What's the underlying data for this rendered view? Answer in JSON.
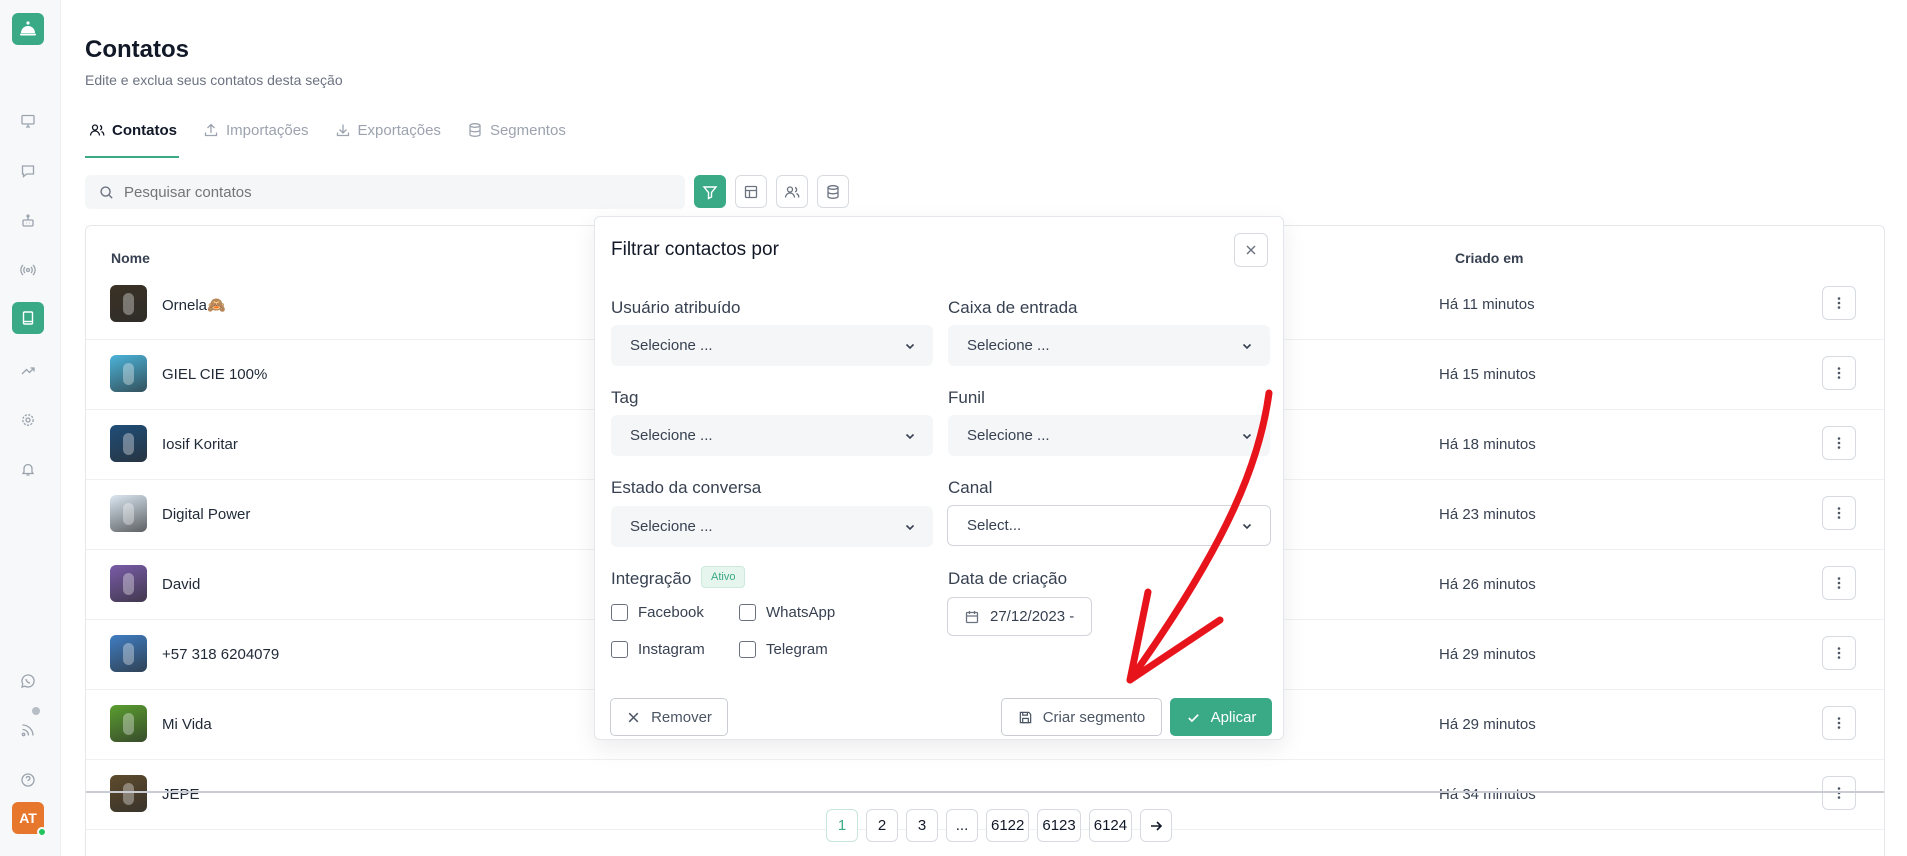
{
  "page": {
    "title": "Contatos",
    "subtitle": "Edite e exclua seus contatos desta seção"
  },
  "tabs": [
    {
      "label": "Contatos",
      "icon": "users-icon",
      "active": true
    },
    {
      "label": "Importações",
      "icon": "upload-icon"
    },
    {
      "label": "Exportações",
      "icon": "download-icon"
    },
    {
      "label": "Segmentos",
      "icon": "database-icon"
    }
  ],
  "search": {
    "placeholder": "Pesquisar contatos"
  },
  "table": {
    "headers": {
      "name": "Nome",
      "created": "Criado em"
    },
    "rows": [
      {
        "name": "Ornela🙈",
        "created": "Há 11 minutos",
        "avatar_color": "#3b3226"
      },
      {
        "name": "GIEL CIE 100%",
        "created": "Há 15 minutos",
        "avatar_color": "#4bb3d9"
      },
      {
        "name": "Iosif Koritar",
        "created": "Há 18 minutos",
        "avatar_color": "#1f4e79"
      },
      {
        "name": "Digital Power",
        "created": "Há 23 minutos",
        "avatar_color": "#dbe7f2"
      },
      {
        "name": "David",
        "created": "Há 26 minutos",
        "avatar_color": "#7a5ca8"
      },
      {
        "name": "+57 318 6204079",
        "created": "Há 29 minutos",
        "avatar_color": "#3f7dc2"
      },
      {
        "name": "Mi Vida",
        "created": "Há 29 minutos",
        "avatar_color": "#5a9e2f"
      },
      {
        "name": "JEPE",
        "created": "Há 34 minutos",
        "avatar_color": "#5e4b2c"
      }
    ]
  },
  "pagination": {
    "pages": [
      "1",
      "2",
      "3",
      "...",
      "6122",
      "6123",
      "6124"
    ],
    "current": "1"
  },
  "filter": {
    "title": "Filtrar contactos por",
    "assigned_user": {
      "label": "Usuário atribuído",
      "value": "Selecione ..."
    },
    "inbox": {
      "label": "Caixa de entrada",
      "value": "Selecione ..."
    },
    "tag": {
      "label": "Tag",
      "value": "Selecione ..."
    },
    "funnel": {
      "label": "Funil",
      "value": "Selecione ..."
    },
    "conversation_state": {
      "label": "Estado da conversa",
      "value": "Selecione ..."
    },
    "channel": {
      "label": "Canal",
      "value": "Select..."
    },
    "integration": {
      "label": "Integração",
      "badge": "Ativo",
      "options": [
        "Facebook",
        "WhatsApp",
        "Instagram",
        "Telegram"
      ]
    },
    "creation_date": {
      "label": "Data de criação",
      "value": "27/12/2023 -"
    },
    "buttons": {
      "remove": "Remover",
      "create_segment": "Criar segmento",
      "apply": "Aplicar"
    }
  },
  "sidebar": {
    "user_initials": "AT"
  },
  "colors": {
    "accent": "#3aa986",
    "annotation_arrow": "#e8141b"
  }
}
